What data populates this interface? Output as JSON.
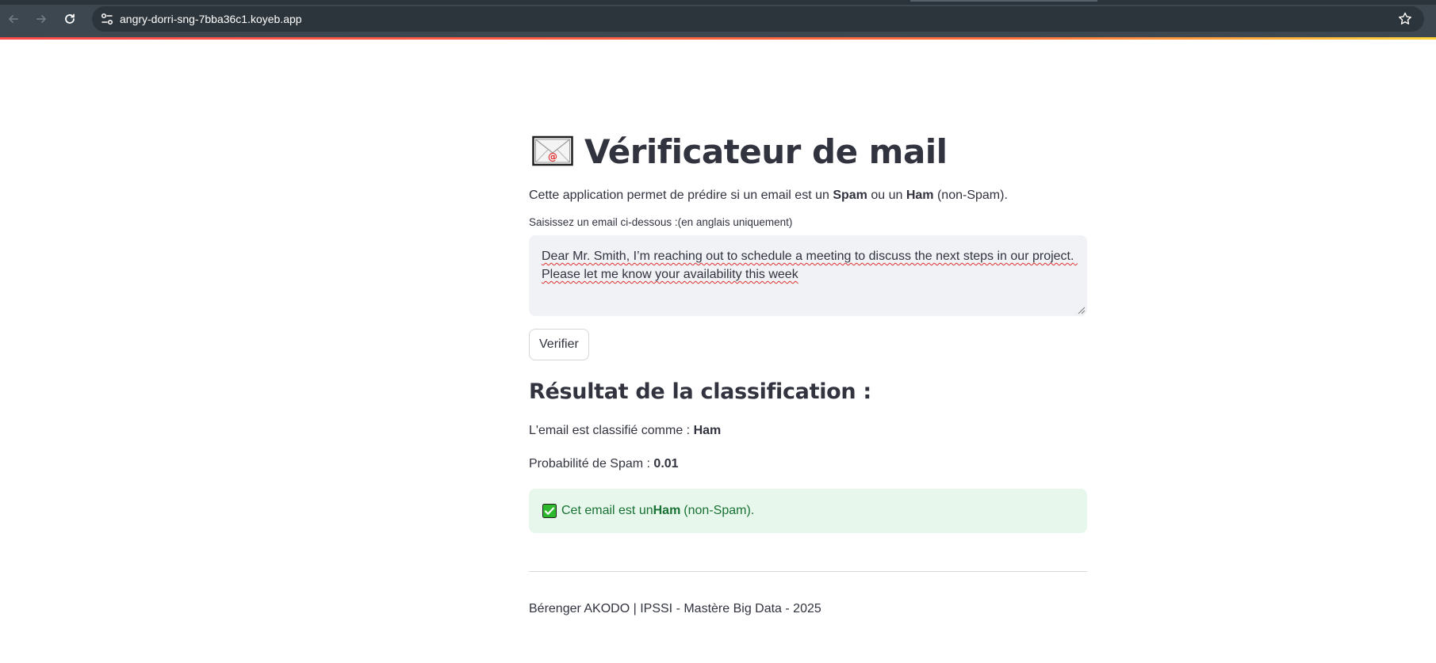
{
  "browser": {
    "url": "angry-dorri-sng-7bba36c1.koyeb.app",
    "icons": {
      "back": "arrow-left-icon",
      "forward": "arrow-right-icon",
      "reload": "reload-icon",
      "site_settings": "tune-icon",
      "bookmark": "star-icon"
    }
  },
  "app": {
    "title_icon": "envelope-icon",
    "title": "Vérificateur de mail",
    "intro": {
      "prefix": "Cette application permet de prédire si un email est un ",
      "spam": "Spam",
      "middle": " ou un ",
      "ham": "Ham",
      "suffix": " (non-Spam)."
    },
    "input_label": "Saisissez un email ci-dessous :(en anglais uniquement)",
    "input_value": "Dear Mr. Smith, I’m reaching out to schedule a meeting to discuss the next steps in our project. Please let me know your availability this week",
    "verify_button": "Verifier",
    "result_heading": "Résultat de la classification :",
    "classification": {
      "label": "L'email est classifié comme : ",
      "value": "Ham"
    },
    "probability": {
      "label": "Probabilité de Spam : ",
      "value": "0.01"
    },
    "success_message": {
      "icon": "check-mark-icon",
      "prefix": "Cet email est un ",
      "ham": "Ham",
      "suffix": " (non-Spam)."
    },
    "footer": "Bérenger AKODO | IPSSI - Mastère Big Data - 2025"
  },
  "colors": {
    "chrome": "#3c474f",
    "accent_bar": "#ff4b4b",
    "success_bg": "#e8f7ec",
    "success_text": "#177233",
    "text": "#31333f"
  }
}
